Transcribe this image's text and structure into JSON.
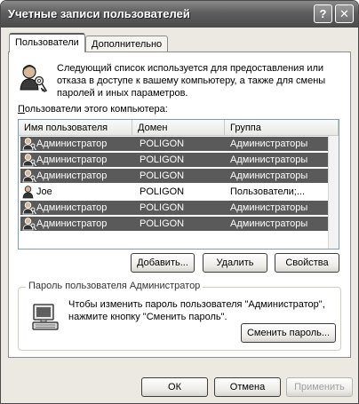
{
  "window": {
    "title": "Учетные записи пользователей",
    "help_glyph": "?",
    "close_glyph": "✕"
  },
  "tabs": [
    {
      "label": "Пользователи",
      "active": true
    },
    {
      "label": "Дополнительно",
      "active": false
    }
  ],
  "intro": {
    "icon": "users-keys-icon",
    "text": "Следующий список используется для предоставления или отказа в доступе к вашему компьютеру, а также для смены паролей и иных параметров."
  },
  "users": {
    "list_label": "Пользователи этого компьютера:",
    "columns": [
      "Имя пользователя",
      "Домен",
      "Группа"
    ],
    "rows": [
      {
        "name": "Администратор",
        "domain": "POLIGON",
        "group": "Администраторы",
        "selected": true,
        "icon": "admin-user-icon"
      },
      {
        "name": "Администратор",
        "domain": "POLIGON",
        "group": "Администраторы",
        "selected": true,
        "icon": "admin-user-icon"
      },
      {
        "name": "Администратор",
        "domain": "POLIGON",
        "group": "Администраторы",
        "selected": true,
        "icon": "admin-user-icon"
      },
      {
        "name": "Joe",
        "domain": "POLIGON",
        "group": "Пользователи;...",
        "selected": false,
        "icon": "user-icon"
      },
      {
        "name": "Администратор",
        "domain": "POLIGON",
        "group": "Администраторы",
        "selected": true,
        "icon": "admin-user-icon"
      },
      {
        "name": "Администратор",
        "domain": "POLIGON",
        "group": "Администраторы",
        "selected": true,
        "icon": "admin-user-icon"
      }
    ]
  },
  "list_buttons": {
    "add_label": "Добавить...",
    "remove_label": "Удалить",
    "properties_label": "Свойства"
  },
  "password_group": {
    "label": "Пароль пользователя Администратор",
    "icon": "computer-icon",
    "text": "Чтобы изменить пароль пользователя \"Администратор\", нажмите кнопку \"Сменить пароль\".",
    "change_button": "Сменить пароль..."
  },
  "dialog_buttons": {
    "ok": "ОК",
    "cancel": "Отмена",
    "apply": "Применить"
  },
  "colors": {
    "selection": "#5a5a5a",
    "titlebar": "#5d5d5d",
    "window_bg": "#ece9e3"
  }
}
